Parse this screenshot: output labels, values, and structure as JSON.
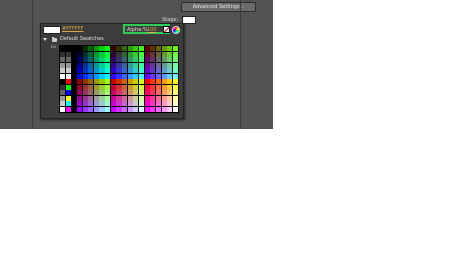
{
  "toolbar": {
    "advanced_settings_label": "Advanced Settings..."
  },
  "stage": {
    "label": "Stage:",
    "color": "#FFFFFF"
  },
  "picker": {
    "hex_value": "#FFFFFF",
    "alpha_label": "Alpha:%",
    "alpha_value": "100",
    "folder_label": "Default Swatches",
    "side_text": "Lis",
    "accent_highlight": "#2ECC53",
    "icons": [
      "twirl-down-icon",
      "folder-icon",
      "no-color-icon",
      "color-wheel-icon"
    ]
  }
}
